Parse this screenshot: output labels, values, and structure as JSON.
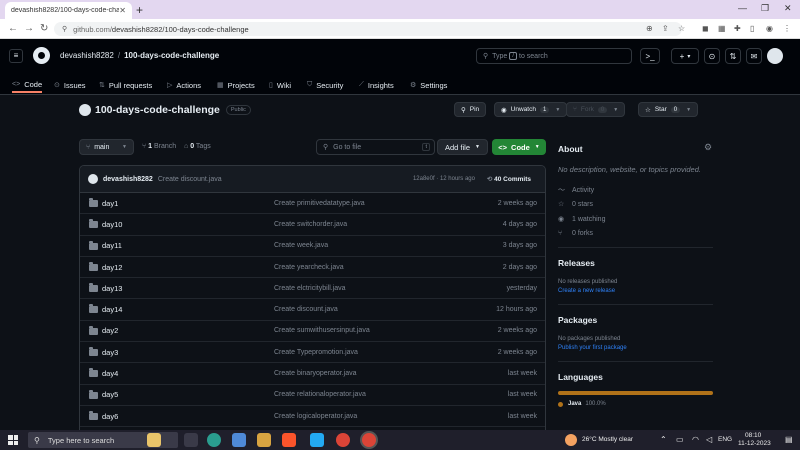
{
  "browser": {
    "tab_title": "devashish8282/100-days-code-challenge",
    "tab_close": "✕",
    "new_tab": "+",
    "url_domain": "github.com/",
    "url_path": "devashish8282/100-days-code-challenge"
  },
  "header": {
    "owner": "devashish8282",
    "separator": "/",
    "repo": "100-days-code-challenge",
    "search_placeholder_pre": "Type",
    "search_key": "/",
    "search_placeholder_post": "to search",
    "plus_label": "+",
    "plus_caret": "▾"
  },
  "repo_nav": {
    "tabs": [
      {
        "label": "Code",
        "icon": "<>"
      },
      {
        "label": "Issues",
        "icon": "⊙"
      },
      {
        "label": "Pull requests",
        "icon": "⇅"
      },
      {
        "label": "Actions",
        "icon": "▷"
      },
      {
        "label": "Projects",
        "icon": "▦"
      },
      {
        "label": "Wiki",
        "icon": "▯"
      },
      {
        "label": "Security",
        "icon": "⛉"
      },
      {
        "label": "Insights",
        "icon": "⟋"
      },
      {
        "label": "Settings",
        "icon": "⚙"
      }
    ]
  },
  "repo": {
    "name": "100-days-code-challenge",
    "visibility": "Public",
    "pin_label": "Pin",
    "unwatch_label": "Unwatch",
    "watch_count": "1",
    "fork_label": "Fork",
    "fork_count": "0",
    "star_label": "Star",
    "star_count": "0",
    "branch_label": "main",
    "branch_count": "1",
    "branch_word": "Branch",
    "tag_count": "0",
    "tag_word": "Tags",
    "gofile_placeholder": "Go to file",
    "gofile_key": "t",
    "addfile_label": "Add file",
    "code_label": "Code"
  },
  "commit": {
    "author": "devashish8282",
    "message": "Create discount.java",
    "sha": "12a8e0f · 12 hours ago",
    "commits": "40 Commits"
  },
  "files": [
    {
      "name": "day1",
      "message": "Create primitivedatatype.java",
      "age": "2 weeks ago"
    },
    {
      "name": "day10",
      "message": "Create switchorder.java",
      "age": "4 days ago"
    },
    {
      "name": "day11",
      "message": "Create week.java",
      "age": "3 days ago"
    },
    {
      "name": "day12",
      "message": "Create yearcheck.java",
      "age": "2 days ago"
    },
    {
      "name": "day13",
      "message": "Create elctricitybill.java",
      "age": "yesterday"
    },
    {
      "name": "day14",
      "message": "Create discount.java",
      "age": "12 hours ago"
    },
    {
      "name": "day2",
      "message": "Create sumwithusersinput.java",
      "age": "2 weeks ago"
    },
    {
      "name": "day3",
      "message": "Create Typepromotion.java",
      "age": "2 weeks ago"
    },
    {
      "name": "day4",
      "message": "Create binaryoperator.java",
      "age": "last week"
    },
    {
      "name": "day5",
      "message": "Create relationaloperator.java",
      "age": "last week"
    },
    {
      "name": "day6",
      "message": "Create logicaloperator.java",
      "age": "last week"
    }
  ],
  "about": {
    "title": "About",
    "description": "No description, website, or topics provided.",
    "activity": "Activity",
    "stars": "0 stars",
    "watching": "1 watching",
    "forks": "0 forks"
  },
  "releases": {
    "title": "Releases",
    "empty": "No releases published",
    "link": "Create a new release"
  },
  "packages": {
    "title": "Packages",
    "empty": "No packages published",
    "link": "Publish your first package"
  },
  "languages": {
    "title": "Languages",
    "name": "Java",
    "percent": "100.0%",
    "percent_value": 100,
    "color": "#b07219"
  },
  "taskbar": {
    "search_placeholder": "Type here to search",
    "weather": "26°C  Mostly clear",
    "lang": "ENG",
    "time": "08:10",
    "date": "11-12-2023"
  }
}
